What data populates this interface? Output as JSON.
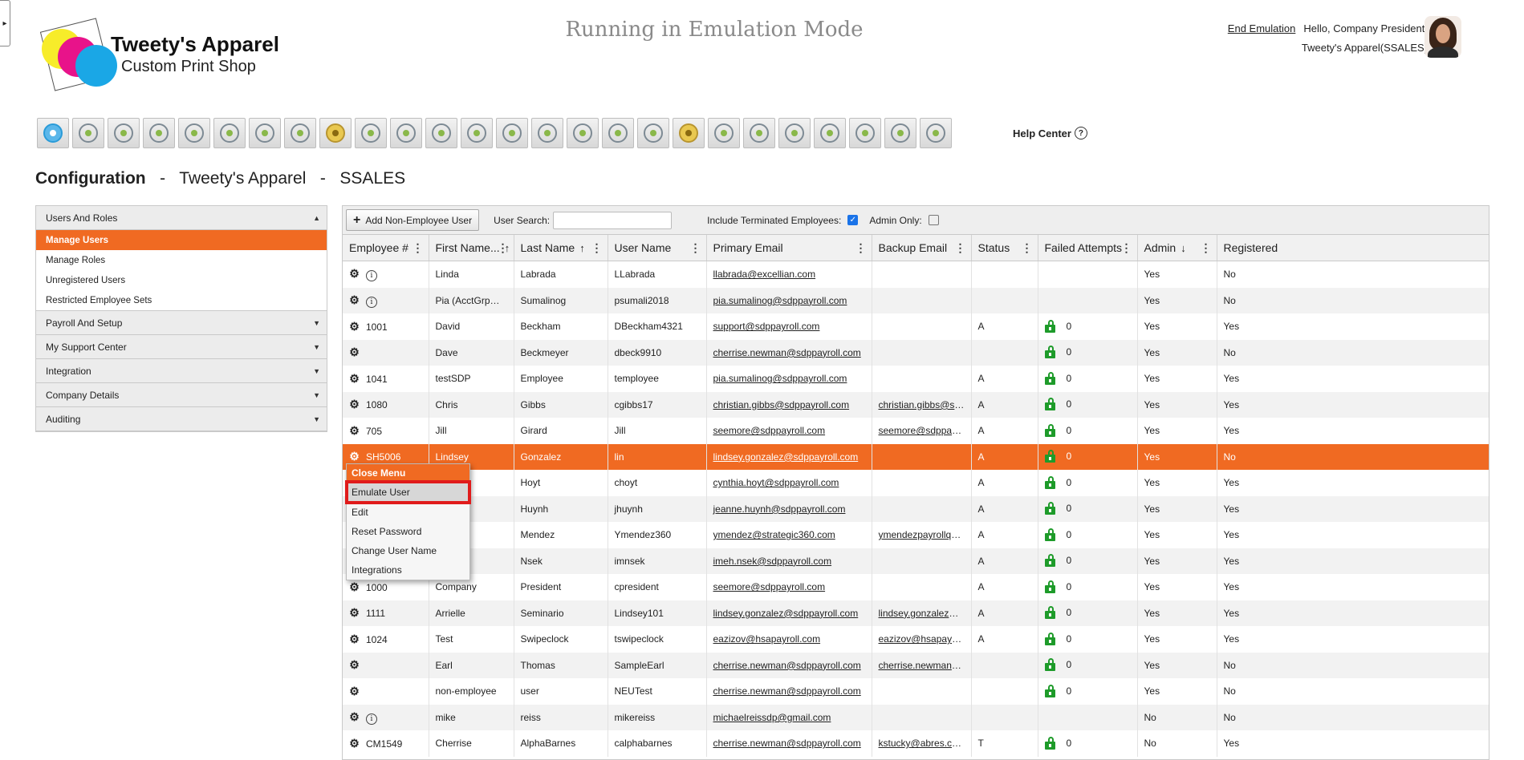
{
  "header": {
    "logo": {
      "name": "Tweety's Apparel",
      "tagline": "Custom Print Shop"
    },
    "emulation_banner": "Running in Emulation Mode",
    "end_emulation": "End Emulation",
    "greeting": "Hello, Company President!",
    "company": "Tweety's Apparel(SSALES)"
  },
  "toolbar": {
    "icons": [
      "home-icon",
      "employee-icon",
      "payroll-icon",
      "time-icon",
      "team-icon",
      "users-icon",
      "org-chart-icon",
      "reports-icon",
      "money-bag-icon",
      "target-icon",
      "target-icon",
      "target-icon",
      "target-icon",
      "transfer-icon",
      "upload-icon",
      "shield-icon",
      "search-money-icon",
      "remove-user-icon",
      "money-bag-icon",
      "group-settings-icon",
      "upload-icon",
      "stacked-coins-icon",
      "search-user-icon",
      "gift-icon",
      "team-settings-icon",
      "review-icon"
    ],
    "help_center": "Help Center",
    "help_icon_glyph": "?"
  },
  "page_title": {
    "section": "Configuration",
    "sep": "-",
    "company": "Tweety's Apparel",
    "code": "SSALES"
  },
  "sidebar": {
    "groups": [
      {
        "label": "Users And Roles",
        "expanded": true,
        "items": [
          "Manage Users",
          "Manage Roles",
          "Unregistered Users",
          "Restricted Employee Sets"
        ],
        "active": "Manage Users"
      },
      {
        "label": "Payroll And Setup"
      },
      {
        "label": "My Support Center"
      },
      {
        "label": "Integration"
      },
      {
        "label": "Company Details"
      },
      {
        "label": "Auditing"
      }
    ]
  },
  "grid_toolbar": {
    "add_button": "Add Non-Employee User",
    "user_search_label": "User Search:",
    "user_search_value": "",
    "include_terminated_label": "Include Terminated Employees:",
    "include_terminated_checked": true,
    "admin_only_label": "Admin Only:",
    "admin_only_checked": false
  },
  "grid": {
    "columns": [
      {
        "label": "Employee #",
        "sort": ""
      },
      {
        "label": "First Name...",
        "sort": "asc"
      },
      {
        "label": "Last Name",
        "sort": "asc"
      },
      {
        "label": "User Name",
        "sort": ""
      },
      {
        "label": "Primary Email",
        "sort": ""
      },
      {
        "label": "Backup Email",
        "sort": ""
      },
      {
        "label": "Status",
        "sort": ""
      },
      {
        "label": "Failed Attempts",
        "sort": ""
      },
      {
        "label": "Admin",
        "sort": "desc"
      },
      {
        "label": "Registered",
        "sort": ""
      }
    ],
    "rows": [
      {
        "emp": "",
        "info": true,
        "first": "Linda",
        "last": "Labrada",
        "user": "LLabrada",
        "email": "llabrada@excellian.com",
        "backup": "",
        "status": "",
        "lock": false,
        "failed": "",
        "admin": "Yes",
        "registered": "No"
      },
      {
        "emp": "",
        "info": true,
        "first": "Pia (AcctGrpMgr)",
        "last": "Sumalinog",
        "user": "psumali2018",
        "email": "pia.sumalinog@sdppayroll.com",
        "backup": "",
        "status": "",
        "lock": false,
        "failed": "",
        "admin": "Yes",
        "registered": "No"
      },
      {
        "emp": "1001",
        "info": false,
        "first": "David",
        "last": "Beckham",
        "user": "DBeckham4321",
        "email": "support@sdppayroll.com",
        "backup": "",
        "status": "A",
        "lock": true,
        "failed": "0",
        "admin": "Yes",
        "registered": "Yes"
      },
      {
        "emp": "",
        "info": false,
        "first": "Dave",
        "last": "Beckmeyer",
        "user": "dbeck9910",
        "email": "cherrise.newman@sdppayroll.com",
        "backup": "",
        "status": "",
        "lock": true,
        "failed": "0",
        "admin": "Yes",
        "registered": "No"
      },
      {
        "emp": "1041",
        "info": false,
        "first": "testSDP",
        "last": "Employee",
        "user": "temployee",
        "email": "pia.sumalinog@sdppayroll.com",
        "backup": "",
        "status": "A",
        "lock": true,
        "failed": "0",
        "admin": "Yes",
        "registered": "Yes"
      },
      {
        "emp": "1080",
        "info": false,
        "first": "Chris",
        "last": "Gibbs",
        "user": "cgibbs17",
        "email": "christian.gibbs@sdppayroll.com",
        "backup": "christian.gibbs@sdppa...",
        "status": "A",
        "lock": true,
        "failed": "0",
        "admin": "Yes",
        "registered": "Yes"
      },
      {
        "emp": "705",
        "info": false,
        "first": "Jill",
        "last": "Girard",
        "user": "Jill",
        "email": "seemore@sdppayroll.com",
        "backup": "seemore@sdppayroll....",
        "status": "A",
        "lock": true,
        "failed": "0",
        "admin": "Yes",
        "registered": "Yes"
      },
      {
        "emp": "SH5006",
        "info": false,
        "first": "Lindsey",
        "last": "Gonzalez",
        "user": "lin",
        "email": "lindsey.gonzalez@sdppayroll.com",
        "backup": "",
        "status": "A",
        "lock": true,
        "failed": "0",
        "admin": "Yes",
        "registered": "No",
        "selected": true
      },
      {
        "emp": "",
        "info": false,
        "first": "hia",
        "last": "Hoyt",
        "user": "choyt",
        "email": "cynthia.hoyt@sdppayroll.com",
        "backup": "",
        "status": "A",
        "lock": true,
        "failed": "0",
        "admin": "Yes",
        "registered": "Yes"
      },
      {
        "emp": "",
        "info": false,
        "first": "s",
        "last": "Huynh",
        "user": "jhuynh",
        "email": "jeanne.huynh@sdppayroll.com",
        "backup": "",
        "status": "A",
        "lock": true,
        "failed": "0",
        "admin": "Yes",
        "registered": "Yes"
      },
      {
        "emp": "",
        "info": false,
        "first": "ne",
        "last": "Mendez",
        "user": "Ymendez360",
        "email": "ymendez@strategic360.com",
        "backup": "ymendezpayrollqueen...",
        "status": "A",
        "lock": true,
        "failed": "0",
        "admin": "Yes",
        "registered": "Yes"
      },
      {
        "emp": "",
        "info": false,
        "first": "",
        "last": "Nsek",
        "user": "imnsek",
        "email": "imeh.nsek@sdppayroll.com",
        "backup": "",
        "status": "A",
        "lock": true,
        "failed": "0",
        "admin": "Yes",
        "registered": "Yes"
      },
      {
        "emp": "1000",
        "info": false,
        "first": "Company",
        "last": "President",
        "user": "cpresident",
        "email": "seemore@sdppayroll.com",
        "backup": "",
        "status": "A",
        "lock": true,
        "failed": "0",
        "admin": "Yes",
        "registered": "Yes"
      },
      {
        "emp": "1111",
        "info": false,
        "first": "Arrielle",
        "last": "Seminario",
        "user": "Lindsey101",
        "email": "lindsey.gonzalez@sdppayroll.com",
        "backup": "lindsey.gonzalez@sdp...",
        "status": "A",
        "lock": true,
        "failed": "0",
        "admin": "Yes",
        "registered": "Yes"
      },
      {
        "emp": "1024",
        "info": false,
        "first": "Test",
        "last": "Swipeclock",
        "user": "tswipeclock",
        "email": "eazizov@hsapayroll.com",
        "backup": "eazizov@hsapayroll.com",
        "status": "A",
        "lock": true,
        "failed": "0",
        "admin": "Yes",
        "registered": "Yes"
      },
      {
        "emp": "",
        "info": false,
        "first": "Earl",
        "last": "Thomas",
        "user": "SampleEarl",
        "email": "cherrise.newman@sdppayroll.com",
        "backup": "cherrise.newman@gm...",
        "status": "",
        "lock": true,
        "failed": "0",
        "admin": "Yes",
        "registered": "No"
      },
      {
        "emp": "",
        "info": false,
        "first": "non-employee",
        "last": "user",
        "user": "NEUTest",
        "email": "cherrise.newman@sdppayroll.com",
        "backup": "",
        "status": "",
        "lock": true,
        "failed": "0",
        "admin": "Yes",
        "registered": "No"
      },
      {
        "emp": "",
        "info": true,
        "first": "mike",
        "last": "reiss",
        "user": "mikereiss",
        "email": "michaelreissdp@gmail.com",
        "backup": "",
        "status": "",
        "lock": false,
        "failed": "",
        "admin": "No",
        "registered": "No"
      },
      {
        "emp": "CM1549",
        "info": false,
        "first": "Cherrise",
        "last": "AlphaBarnes",
        "user": "calphabarnes",
        "email": "cherrise.newman@sdppayroll.com",
        "backup": "kstucky@abres.com",
        "status": "T",
        "lock": true,
        "failed": "0",
        "admin": "No",
        "registered": "Yes"
      }
    ]
  },
  "context_menu": {
    "close": "Close Menu",
    "items": [
      "Emulate User",
      "Edit",
      "Reset Password",
      "Change User Name",
      "Integrations"
    ],
    "highlighted": "Emulate User"
  },
  "colors": {
    "accent": "#f06a22",
    "highlight_border": "#e01b1b",
    "lock_green": "#1e9b2a"
  }
}
